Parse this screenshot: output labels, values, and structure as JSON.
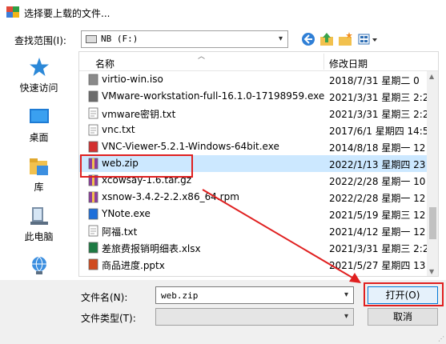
{
  "window": {
    "title": "选择要上载的文件..."
  },
  "lookin": {
    "label": "查找范围(I):",
    "value": "NB (F:)"
  },
  "toolbar": {
    "back_icon": "back-arrow-icon",
    "up_icon": "up-folder-icon",
    "new_folder_icon": "new-folder-icon",
    "view_icon": "view-menu-icon"
  },
  "places": [
    {
      "label": "快速访问",
      "icon": "star-icon"
    },
    {
      "label": "桌面",
      "icon": "desktop-icon"
    },
    {
      "label": "库",
      "icon": "library-icon"
    },
    {
      "label": "此电脑",
      "icon": "computer-icon"
    },
    {
      "label": "网络",
      "icon": "network-icon"
    }
  ],
  "filelist": {
    "columns": [
      "名称",
      "修改日期"
    ],
    "rows": [
      {
        "name": "virtio-win.iso",
        "date": "2018/7/31 星期二 0",
        "icon": "disc-file-icon"
      },
      {
        "name": "VMware-workstation-full-16.1.0-17198959.exe",
        "date": "2021/3/31 星期三 2:2",
        "icon": "vmware-icon"
      },
      {
        "name": "vmware密钥.txt",
        "date": "2021/3/31 星期三 2:2",
        "icon": "text-file-icon"
      },
      {
        "name": "vnc.txt",
        "date": "2017/6/1 星期四 14:5",
        "icon": "text-file-icon"
      },
      {
        "name": "VNC-Viewer-5.2.1-Windows-64bit.exe",
        "date": "2014/8/18 星期一 12",
        "icon": "vnc-icon"
      },
      {
        "name": "web.zip",
        "date": "2022/1/13 星期四 23",
        "icon": "archive-icon",
        "selected": true
      },
      {
        "name": "xcowsay-1.6.tar.gz",
        "date": "2022/2/28 星期一 10",
        "icon": "archive-icon"
      },
      {
        "name": "xsnow-3.4.2-2.2.x86_64.rpm",
        "date": "2022/2/28 星期一 12",
        "icon": "archive-icon"
      },
      {
        "name": "YNote.exe",
        "date": "2021/5/19 星期三 12",
        "icon": "ynote-icon"
      },
      {
        "name": "阿福.txt",
        "date": "2021/4/12 星期一 12",
        "icon": "text-file-icon"
      },
      {
        "name": "差旅费报销明细表.xlsx",
        "date": "2021/3/31 星期三 2:2",
        "icon": "excel-icon"
      },
      {
        "name": "商品进度.pptx",
        "date": "2021/5/27 星期四 13",
        "icon": "ppt-icon"
      }
    ]
  },
  "bottom": {
    "filename_label": "文件名(N):",
    "filename_value": "web.zip",
    "filetype_label": "文件类型(T):",
    "filetype_value": "",
    "open_label": "打开(O)",
    "cancel_label": "取消"
  },
  "colors": {
    "annotation": "#e02020",
    "selected_row": "#cce8ff",
    "accent": "#0078d7"
  }
}
